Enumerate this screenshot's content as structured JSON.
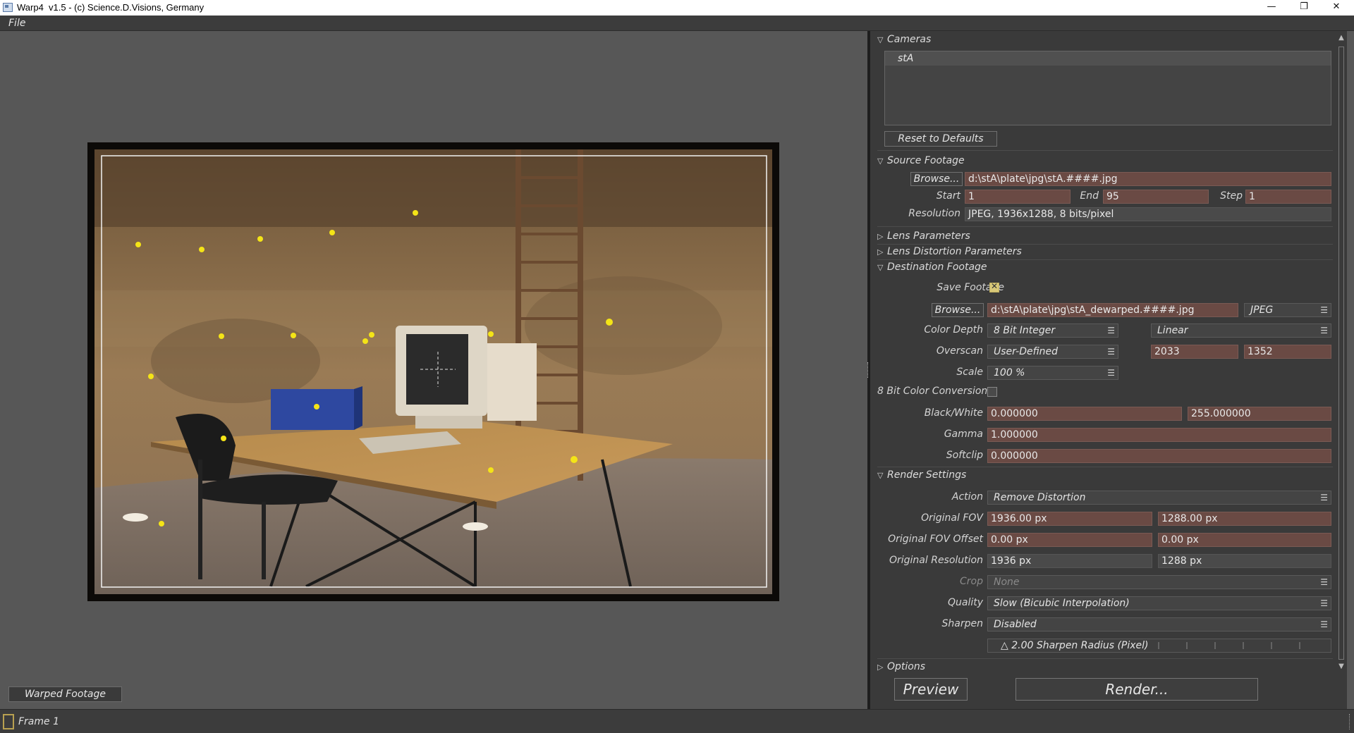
{
  "window": {
    "title": "Warp4  v1.5 - (c) Science.D.Visions, Germany",
    "minimize": "—",
    "restore": "❐",
    "close": "✕"
  },
  "menu": {
    "file": "File"
  },
  "viewer": {
    "warped_footage_button": "Warped Footage"
  },
  "cameras": {
    "header": "Cameras",
    "items": [
      "stA"
    ],
    "reset_button": "Reset to Defaults"
  },
  "source_footage": {
    "header": "Source Footage",
    "browse": "Browse...",
    "path": "d:\\stA\\plate\\jpg\\stA.####.jpg",
    "start_label": "Start",
    "start": "1",
    "end_label": "End",
    "end": "95",
    "step_label": "Step",
    "step": "1",
    "resolution_label": "Resolution",
    "resolution": "JPEG, 1936x1288, 8 bits/pixel"
  },
  "lens_parameters": {
    "header": "Lens Parameters"
  },
  "lens_distortion_parameters": {
    "header": "Lens Distortion Parameters"
  },
  "destination_footage": {
    "header": "Destination Footage",
    "save_footage_label": "Save Footage",
    "save_footage": true,
    "browse": "Browse...",
    "path": "d:\\stA\\plate\\jpg\\stA_dewarped.####.jpg",
    "format": "JPEG",
    "color_depth_label": "Color Depth",
    "color_depth": "8 Bit Integer",
    "color_space": "Linear",
    "overscan_label": "Overscan",
    "overscan": "User-Defined",
    "overscan_w": "2033",
    "overscan_h": "1352",
    "scale_label": "Scale",
    "scale": "100 %",
    "bit_conversion_label": "8 Bit Color Conversion",
    "bit_conversion": false,
    "black_white_label": "Black/White",
    "black": "0.000000",
    "white": "255.000000",
    "gamma_label": "Gamma",
    "gamma": "1.000000",
    "softclip_label": "Softclip",
    "softclip": "0.000000"
  },
  "render_settings": {
    "header": "Render Settings",
    "action_label": "Action",
    "action": "Remove Distortion",
    "original_fov_label": "Original FOV",
    "original_fov_w": "1936.00 px",
    "original_fov_h": "1288.00 px",
    "original_fov_offset_label": "Original FOV Offset",
    "original_fov_offset_x": "0.00 px",
    "original_fov_offset_y": "0.00 px",
    "original_resolution_label": "Original Resolution",
    "original_resolution_w": "1936 px",
    "original_resolution_h": "1288 px",
    "crop_label": "Crop",
    "crop": "None",
    "quality_label": "Quality",
    "quality": "Slow (Bicubic Interpolation)",
    "sharpen_label": "Sharpen",
    "sharpen": "Disabled",
    "sharpen_radius": "2.00 Sharpen Radius (Pixel)"
  },
  "options": {
    "header": "Options"
  },
  "buttons": {
    "preview": "Preview",
    "render": "Render..."
  },
  "status": {
    "frame": "Frame 1"
  },
  "colors": {
    "field_bg": "#6a4a44",
    "panel_bg": "#3a3a3a",
    "viewer_bg": "#575757",
    "marker": "#f4e417"
  }
}
